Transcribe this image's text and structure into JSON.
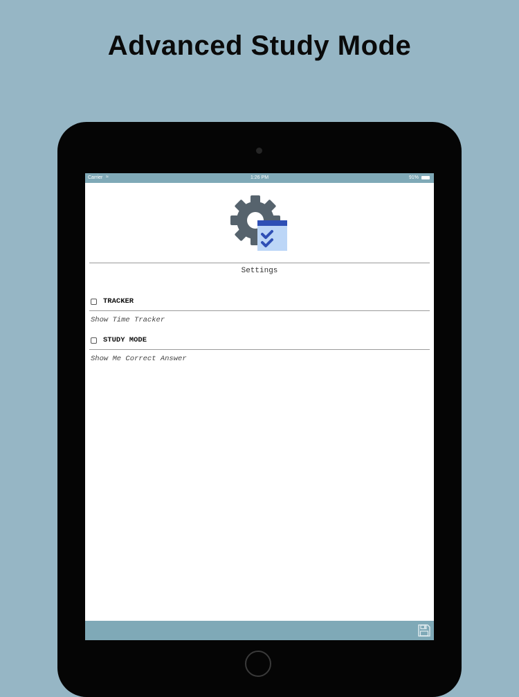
{
  "headline": "Advanced Study Mode",
  "status_bar": {
    "carrier": "Carrier",
    "time": "1:26 PM",
    "battery": "91%"
  },
  "settings_title": "Settings",
  "options": [
    {
      "label": "TRACKER",
      "description": "Show Time Tracker",
      "checked": false
    },
    {
      "label": "STUDY MODE",
      "description": "Show Me Correct Answer",
      "checked": false
    }
  ],
  "icons": {
    "logo": "settings-gear-checklist-icon",
    "save": "save-floppy-icon"
  },
  "colors": {
    "background": "#96b6c5",
    "accent_bar": "#7fa9b7",
    "gear": "#56636d",
    "checklist_accent": "#2e4fb5"
  }
}
